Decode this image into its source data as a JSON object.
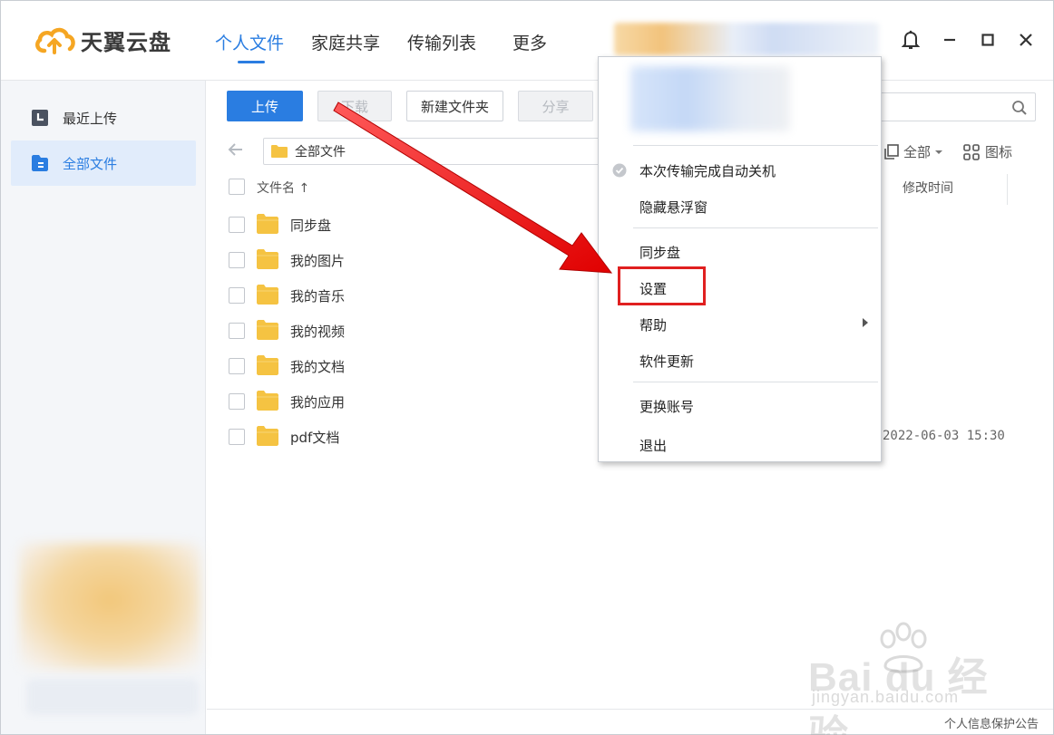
{
  "app": {
    "name": "天翼云盘"
  },
  "nav": {
    "tabs": [
      "个人文件",
      "家庭共享",
      "传输列表"
    ],
    "more": "更多"
  },
  "sidebar": {
    "items": [
      {
        "label": "最近上传",
        "icon": "recent-upload-icon"
      },
      {
        "label": "全部文件",
        "icon": "all-files-icon"
      }
    ]
  },
  "toolbar": {
    "upload": "上传",
    "download": "下载",
    "new_folder": "新建文件夹",
    "share": "分享"
  },
  "path": {
    "current": "全部文件"
  },
  "view": {
    "filter": "全部",
    "mode": "图标"
  },
  "table": {
    "col_name": "文件名 ↑",
    "col_time": "修改时间"
  },
  "files": [
    {
      "name": "同步盘",
      "time": ""
    },
    {
      "name": "我的图片",
      "time": ""
    },
    {
      "name": "我的音乐",
      "time": ""
    },
    {
      "name": "我的视频",
      "time": ""
    },
    {
      "name": "我的文档",
      "time": ""
    },
    {
      "name": "我的应用",
      "time": ""
    },
    {
      "name": "pdf文档",
      "time": "2022-06-03 15:30"
    }
  ],
  "menu": {
    "items": [
      "本次传输完成自动关机",
      "隐藏悬浮窗",
      "同步盘",
      "设置",
      "帮助",
      "软件更新",
      "更换账号",
      "退出"
    ],
    "highlighted": "设置"
  },
  "footer": {
    "notice": "个人信息保护公告"
  },
  "watermark": {
    "brand": "Bai du 经验",
    "url": "jingyan.baidu.com"
  },
  "colors": {
    "accent": "#2a7de1",
    "folder": "#f5c342",
    "annotation": "#e02020"
  }
}
